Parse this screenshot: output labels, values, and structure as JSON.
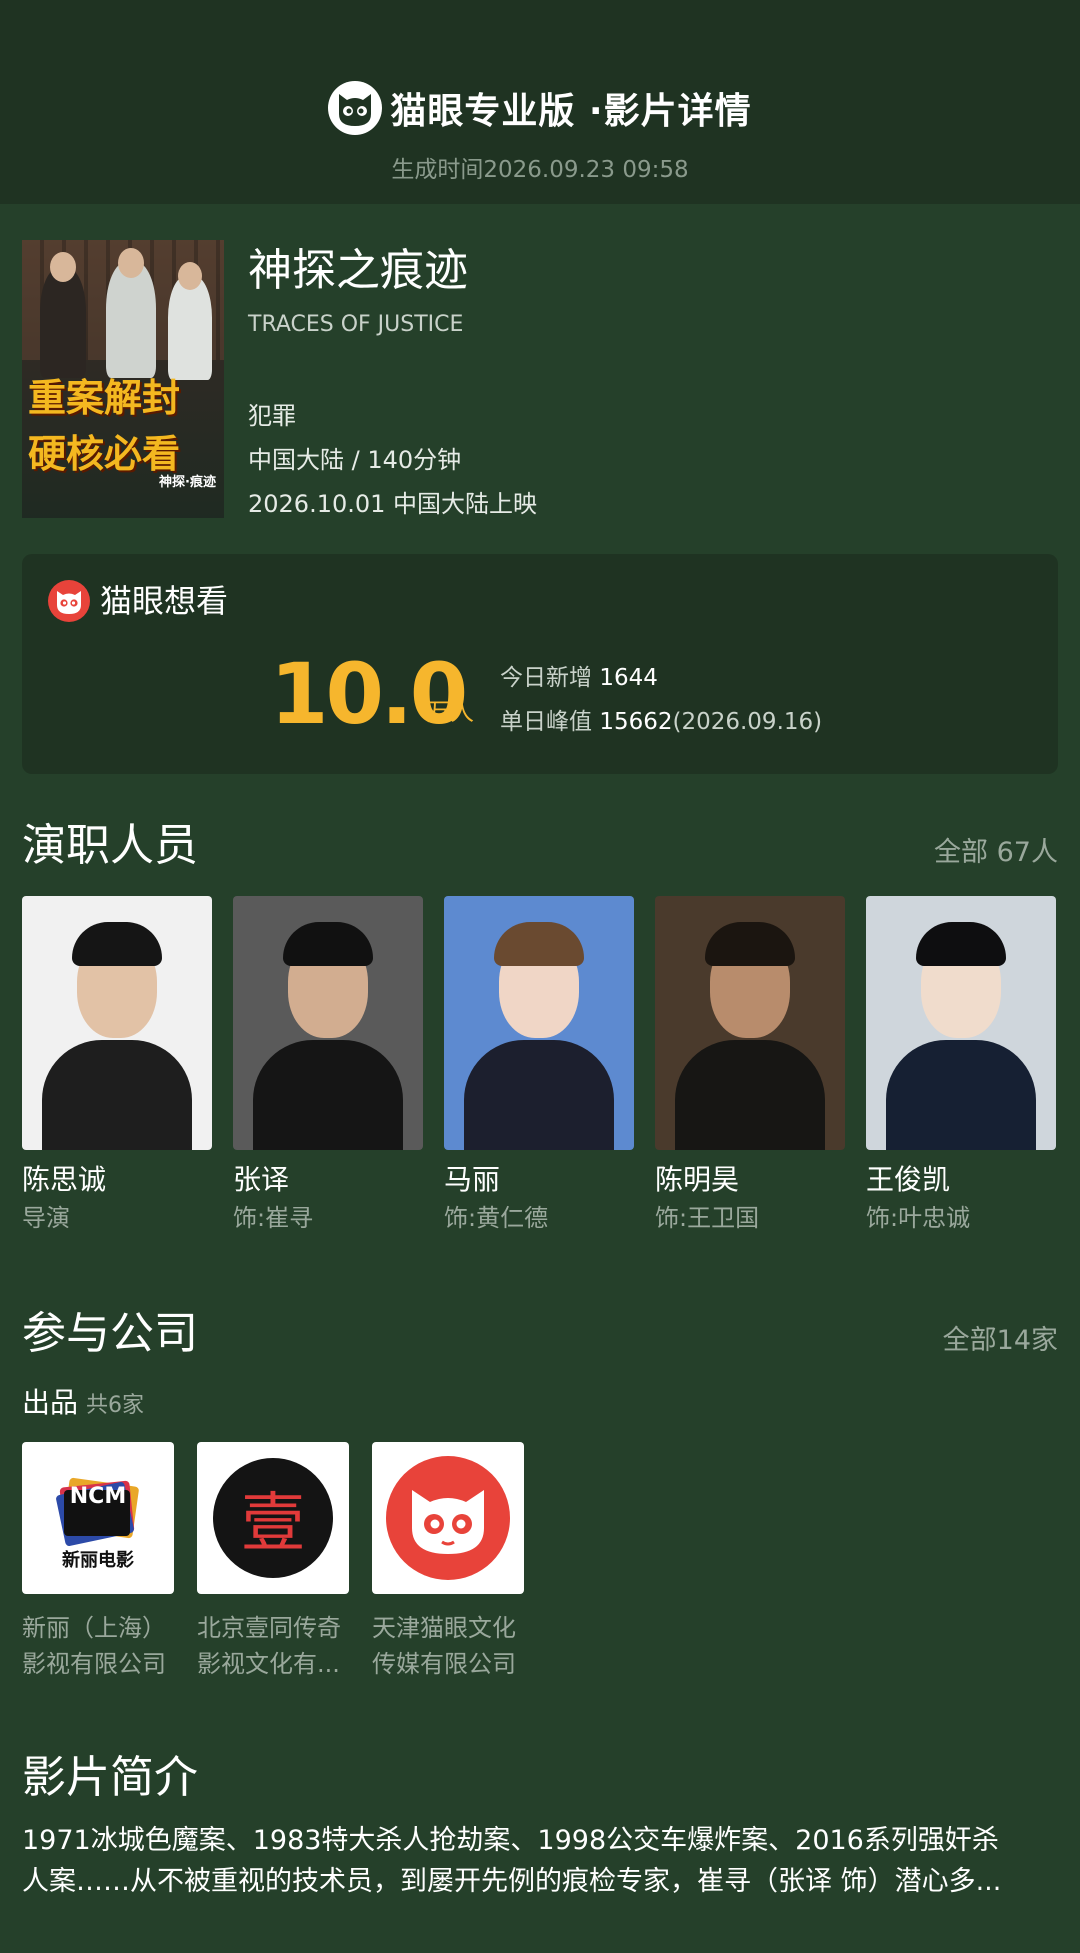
{
  "header": {
    "brand_title": "猫眼专业版 ·影片详情",
    "generated_time": "生成时间2026.09.23 09:58"
  },
  "movie": {
    "title": "神探之痕迹",
    "english_title": "TRACES OF JUSTICE",
    "genre": "犯罪",
    "region_duration": "中国大陆 / 140分钟",
    "release": "2026.10.01 中国大陆上映",
    "poster": {
      "headline_line1": "重案解封",
      "headline_line2": "硬核必看",
      "caption": "神探·痕迹"
    }
  },
  "want": {
    "title": "猫眼想看",
    "count": "10.0",
    "unit": "万人",
    "today_label": "今日新增",
    "today_value": "1644",
    "peak_label": "单日峰值",
    "peak_value": "15662",
    "peak_date": "(2026.09.16)"
  },
  "cast_section": {
    "title": "演职人员",
    "more": "全部 67人",
    "members": [
      {
        "name": "陈思诚",
        "role": "导演"
      },
      {
        "name": "张译",
        "role": "饰:崔寻"
      },
      {
        "name": "马丽",
        "role": "饰:黄仁德"
      },
      {
        "name": "陈明昊",
        "role": "饰:王卫国"
      },
      {
        "name": "王俊凯",
        "role": "饰:叶忠诚"
      }
    ]
  },
  "company_section": {
    "title": "参与公司",
    "more": "全部14家",
    "sub_title": "出品",
    "sub_count": "共6家",
    "companies": [
      {
        "line1": "新丽（上海）",
        "line2": "影视有限公司",
        "logo_text": "NCM",
        "logo_caption": "新丽电影"
      },
      {
        "line1": "北京壹同传奇",
        "line2": "影视文化有...",
        "logo_text": "壹"
      },
      {
        "line1": "天津猫眼文化",
        "line2": "传媒有限公司"
      }
    ]
  },
  "synopsis": {
    "title": "影片简介",
    "line1": "1971冰城色魔案、1983特大杀人抢劫案、1998公交车爆炸案、2016系列强奸杀",
    "line2": "人案……从不被重视的技术员，到屡开先例的痕检专家，崔寻（张译 饰）潜心多..."
  },
  "colors": {
    "background": "#25402a",
    "header": "#1f3322",
    "accent": "#f6b62d",
    "maoyan_red": "#e8433a"
  }
}
